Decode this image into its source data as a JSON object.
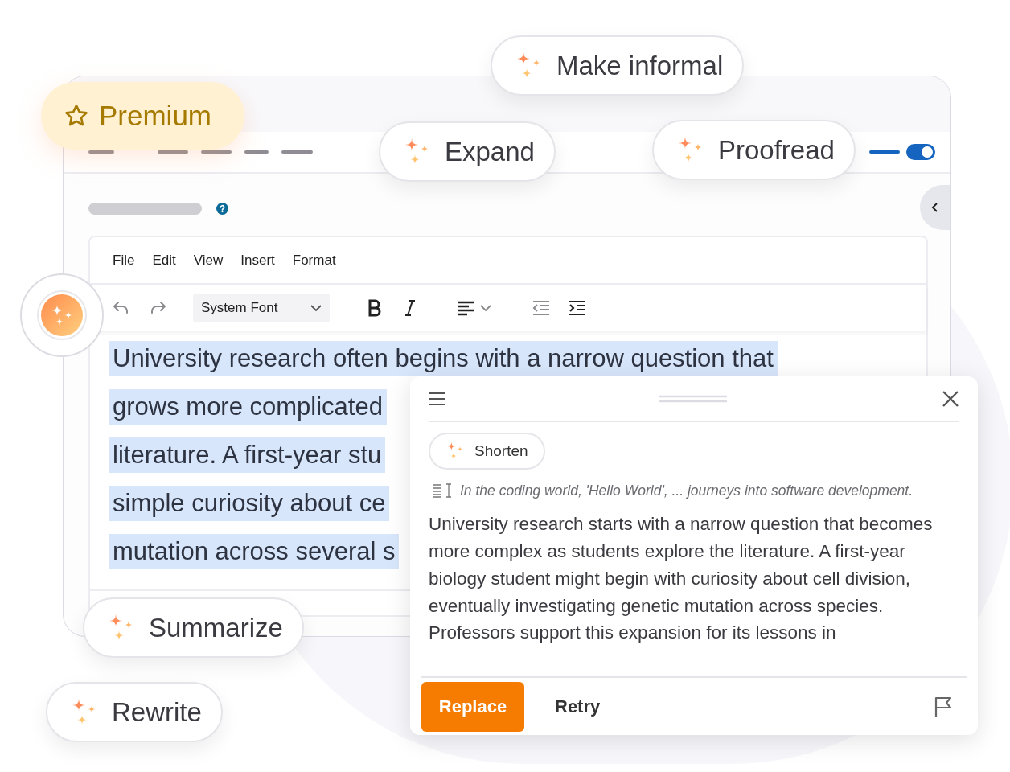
{
  "badge": {
    "label": "Premium"
  },
  "actions": [
    {
      "label": "Make informal"
    },
    {
      "label": "Expand"
    },
    {
      "label": "Proofread"
    },
    {
      "label": "Summarize"
    },
    {
      "label": "Rewrite"
    }
  ],
  "toggle": {
    "on": true
  },
  "editor": {
    "menu": [
      "File",
      "Edit",
      "View",
      "Insert",
      "Format"
    ],
    "font": "System Font",
    "lines": [
      {
        "text": "University research often begins with a narrow question that",
        "selected": true
      },
      {
        "text": "grows more complicated",
        "selected": true
      },
      {
        "text": "literature. A first-year stu",
        "selected": true
      },
      {
        "text": "simple curiosity about ce",
        "selected": true
      },
      {
        "text": "mutation across several s",
        "selected": true
      }
    ]
  },
  "panel": {
    "chip": "Shorten",
    "source": "In the coding world, 'Hello World', ... journeys into software development.",
    "result": "University research starts with a narrow question that becomes more complex as students explore the literature. A first-year biology student might begin with curiosity about cell division, eventually investigating genetic mutation across species. Professors support this expansion for its lessons in",
    "buttons": [
      {
        "label": "Replace",
        "kind": "primary"
      },
      {
        "label": "Retry",
        "kind": "secondary"
      }
    ]
  }
}
